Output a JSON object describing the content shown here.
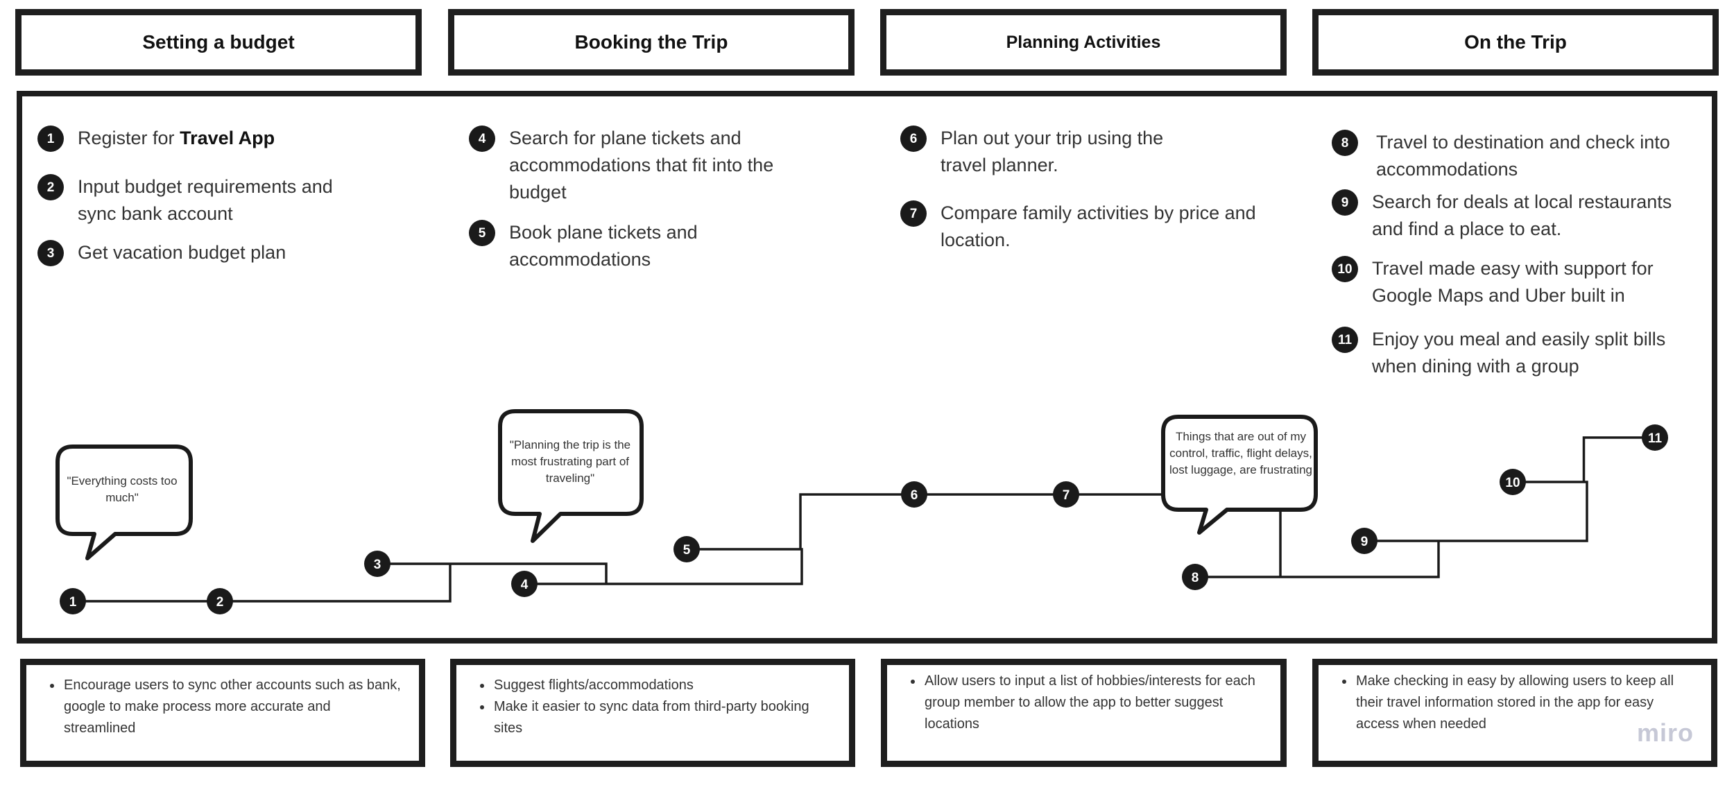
{
  "columns": [
    {
      "title": "Setting a budget",
      "steps": [
        {
          "num": "1",
          "text": "Register for ",
          "bold": "Travel App"
        },
        {
          "num": "2",
          "text": "Input budget requirements and sync bank account"
        },
        {
          "num": "3",
          "text": "Get vacation budget plan"
        }
      ],
      "ideas": [
        "Encourage users to sync other accounts such as bank, google to make process more accurate and streamlined"
      ]
    },
    {
      "title": "Booking the Trip",
      "steps": [
        {
          "num": "4",
          "text": "Search for plane tickets and accommodations that fit into the budget"
        },
        {
          "num": "5",
          "text": "Book plane tickets and accommodations"
        }
      ],
      "ideas": [
        "Suggest flights/accommodations",
        "Make it easier to sync data from third-party booking sites"
      ]
    },
    {
      "title": "Planning Activities",
      "steps": [
        {
          "num": "6",
          "text": "Plan out your trip using the travel planner."
        },
        {
          "num": "7",
          "text": "Compare family activities by price and location."
        }
      ],
      "ideas": [
        "Allow users to input a list of hobbies/interests for each group member to allow the app to better suggest locations"
      ]
    },
    {
      "title": "On the Trip",
      "steps": [
        {
          "num": "8",
          "text": "Travel to destination and check into accommodations"
        },
        {
          "num": "9",
          "text": "Search for deals at local restaurants and find a place to eat."
        },
        {
          "num": "10",
          "text": "Travel made easy with support for Google Maps and Uber built in"
        },
        {
          "num": "11",
          "text": "Enjoy you meal and easily split bills when dining with a group"
        }
      ],
      "ideas": [
        "Make checking in easy by allowing users to keep all their travel information stored in the app for easy access when needed"
      ]
    }
  ],
  "quotes": [
    "\"Everything costs too much\"",
    "\"Planning the trip is the most frustrating part of traveling\"",
    "Things that are out of my control, traffic, flight delays, lost luggage, are frustrating"
  ],
  "journey_nodes": [
    "1",
    "2",
    "3",
    "4",
    "5",
    "6",
    "7",
    "8",
    "9",
    "10",
    "11"
  ],
  "watermark": "miro",
  "colors": {
    "ink": "#1a1a1a",
    "text": "#333333",
    "watermark": "#c6c8d6"
  }
}
